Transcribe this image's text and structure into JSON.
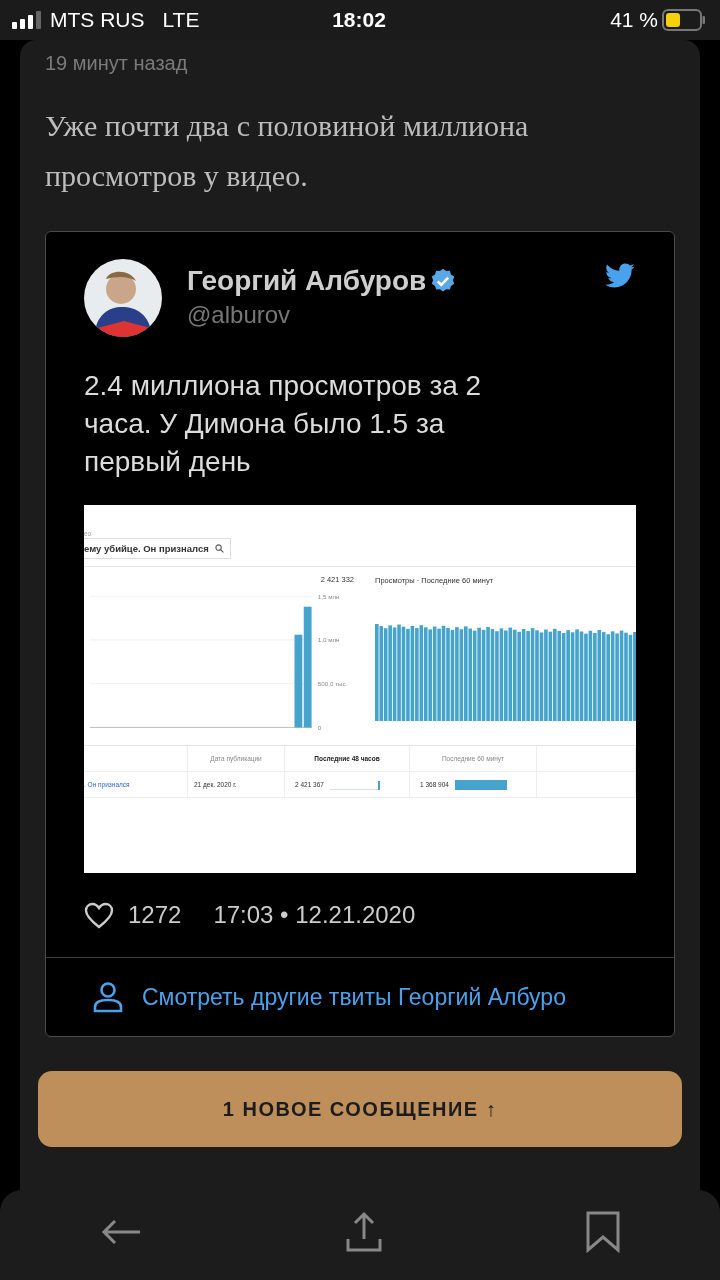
{
  "status_bar": {
    "carrier": "MTS RUS",
    "network": "LTE",
    "time": "18:02",
    "battery_percent": "41 %"
  },
  "post": {
    "time_ago": "19 минут назад",
    "text": "Уже почти два с половиной миллиона просмотров у видео."
  },
  "tweet": {
    "author": "Георгий Албуров",
    "verified": true,
    "handle": "@alburov",
    "text": "2.4 миллиона просмотров за 2 часа. У Димона было 1.5 за первый день",
    "screenshot": {
      "label_fragment": "ео",
      "search_value": "ему убийце. Он признался",
      "chart_total": "2 421 332",
      "chart_data": {
        "type": "bar",
        "grid": true,
        "values": [
          0,
          0,
          0,
          0,
          0,
          0,
          0,
          0,
          0,
          0,
          0,
          0,
          0,
          0,
          0,
          0,
          0,
          0,
          0,
          0,
          0,
          0,
          1.06,
          1.38
        ],
        "ylim": [
          0,
          1.5
        ],
        "yticks": [
          {
            "value": 0,
            "label": "0"
          },
          {
            "value": 1.0,
            "label": "1,0 млн"
          },
          {
            "value": 1.5,
            "label": "1,5 млн"
          }
        ]
      },
      "midpoint_tick_label": "500,0 тыс.",
      "panel_title": "Просмотры · Последние 60 минут",
      "columns": [
        {
          "label": "Дата публикации",
          "sorted": false
        },
        {
          "label": "Последние 48 часов",
          "sorted": true
        },
        {
          "label": "Последние 60 минут",
          "sorted": false
        }
      ],
      "rows": [
        {
          "title": ". Он признался",
          "date": "21 дек. 2020 г.",
          "views_48h": "2 421 367",
          "views_60m": "1 368 904"
        }
      ]
    },
    "likes": "1272",
    "timestamp": "17:03 • 12.21.2020",
    "more_link": "Смотреть другие твиты Георгий Албуро"
  },
  "new_messages_button": "1 НОВОЕ СООБЩЕНИЕ ↑"
}
